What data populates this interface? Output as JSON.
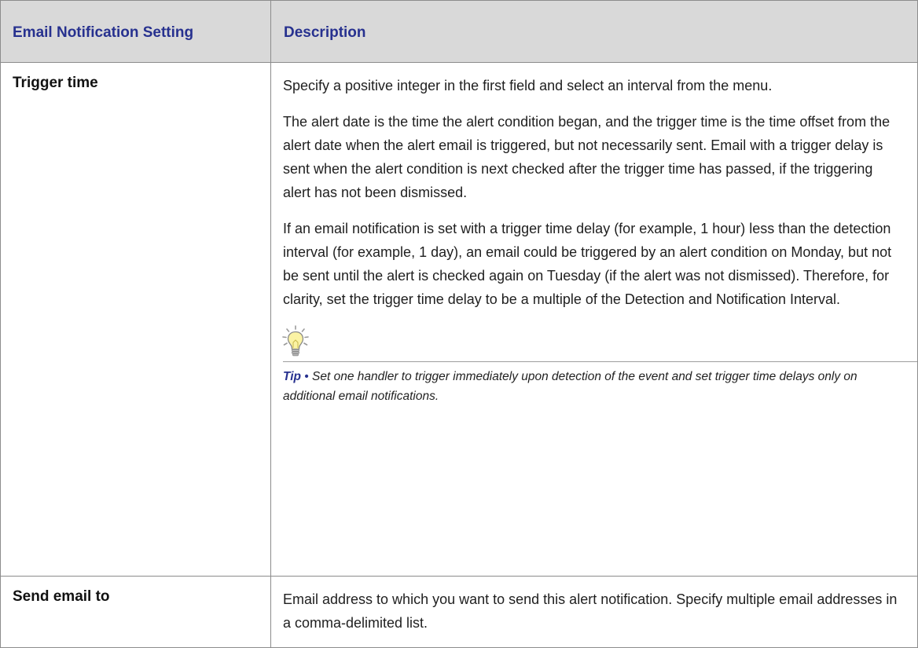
{
  "table": {
    "headers": {
      "setting": "Email Notification Setting",
      "description": "Description"
    },
    "rows": [
      {
        "setting": "Trigger time",
        "paragraphs": [
          "Specify a positive integer in the first field and select an interval from the menu.",
          "The alert date is the time the alert condition began, and the trigger time is the time offset from the alert date when the alert email is triggered, but not necessarily sent. Email with a trigger delay is sent when the alert condition is next checked after the trigger time has passed, if the triggering alert has not been dismissed.",
          "If an email notification is set with a trigger time delay (for example, 1 hour) less than the detection interval (for example, 1 day), an email could be triggered by an alert condition on Monday, but not be sent until the alert is checked again on Tuesday (if the alert was not dismissed). Therefore, for clarity, set the trigger time delay to be a multiple of the Detection and Notification Interval."
        ],
        "tip": {
          "icon": "lightbulb-icon",
          "label": "Tip",
          "bullet": "•",
          "text": "Set one handler to trigger immediately upon detection of the event and set trigger time delays only on additional email notifications."
        }
      },
      {
        "setting": "Send email to",
        "paragraphs": [
          "Email address to which you want to send this alert notification. Specify multiple email addresses in a comma-delimited list."
        ]
      }
    ]
  },
  "colors": {
    "header_bg": "#d9d9d9",
    "header_text": "#27318f",
    "border": "#8c8c8c",
    "tip_accent": "#27318f"
  }
}
